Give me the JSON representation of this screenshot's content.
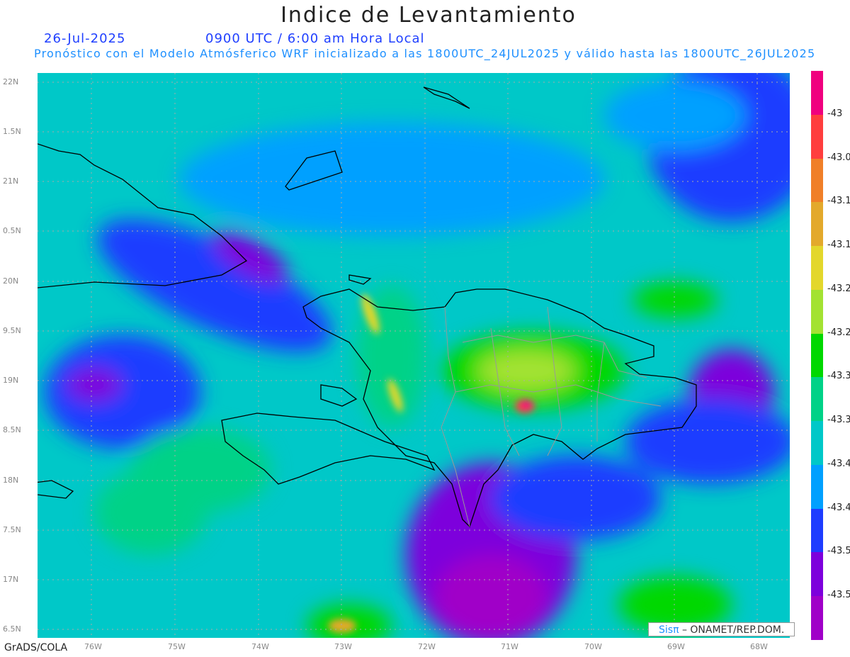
{
  "title": "Indice de Levantamiento",
  "date": "26-Jul-2025",
  "time": "0900 UTC / 6:00 am Hora Local",
  "subtitle": "Pronóstico con el Modelo Atmósferico WRF inicializado a las 1800UTC_24JUL2025 y válido hasta las  1800UTC_26JUL2025",
  "lat_ticks": [
    "22N",
    "1.5N",
    "21N",
    "0.5N",
    "20N",
    "9.5N",
    "19N",
    "8.5N",
    "18N",
    "7.5N",
    "17N",
    "6.5N"
  ],
  "lon_ticks": [
    "76W",
    "75W",
    "74W",
    "73W",
    "72W",
    "71W",
    "70W",
    "69W",
    "68W"
  ],
  "colorbar": {
    "colors": [
      "#f0007f",
      "#ff3e3e",
      "#f07f28",
      "#e3a92c",
      "#e3d72c",
      "#a3e232",
      "#00d800",
      "#00d287",
      "#00c8c8",
      "#00a0ff",
      "#1e3cff",
      "#7d00dc",
      "#a000c8"
    ],
    "labels": [
      "-43",
      "-43.0",
      "-43.1",
      "-43.1",
      "-43.2",
      "-43.2",
      "-43.3",
      "-43.3",
      "-43.4",
      "-43.4",
      "-43.5",
      "-43.5"
    ]
  },
  "credit": {
    "logo": "Sisπ",
    "text": "–  ONAMET/REP.DOM."
  },
  "footer": "GrADS/COLA"
}
